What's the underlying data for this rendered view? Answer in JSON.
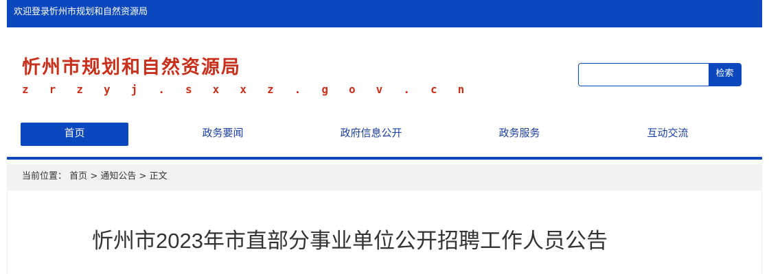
{
  "topbar": {
    "welcome": "欢迎登录忻州市规划和自然资源局"
  },
  "header": {
    "title": "忻州市规划和自然资源局",
    "domain": "z r z y j . s x x z . g o v . c n",
    "search": {
      "placeholder": "",
      "value": "",
      "button_label": "检索"
    }
  },
  "nav": {
    "items": [
      {
        "label": "首页",
        "active": true
      },
      {
        "label": "政务要闻",
        "active": false
      },
      {
        "label": "政府信息公开",
        "active": false
      },
      {
        "label": "政务服务",
        "active": false
      },
      {
        "label": "互动交流",
        "active": false
      }
    ]
  },
  "breadcrumb": {
    "prefix": "当前位置：",
    "items": [
      "首页",
      "通知公告",
      "正文"
    ],
    "separator": ">"
  },
  "article": {
    "title": "忻州市2023年市直部分事业单位公开招聘工作人员公告"
  },
  "colors": {
    "brand_blue": "#0b48be",
    "logo_red": "#c9301c",
    "breadcrumb_bg": "#f2f2f2"
  }
}
